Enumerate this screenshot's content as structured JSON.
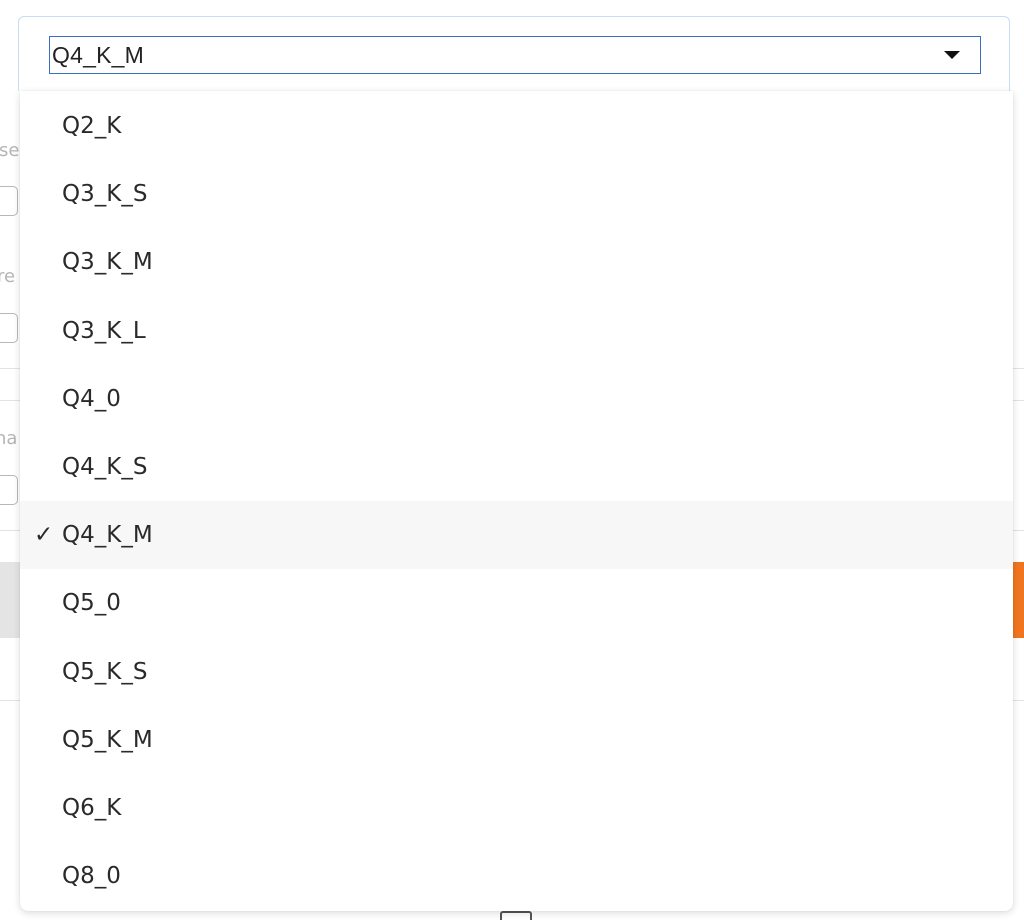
{
  "background": {
    "labels": [
      "lse",
      "re",
      "ha"
    ]
  },
  "select": {
    "value": "Q4_K_M",
    "caret_icon": "chevron-down-icon"
  },
  "dropdown": {
    "check_glyph": "✓",
    "selected_index": 6,
    "options": [
      "Q2_K",
      "Q3_K_S",
      "Q3_K_M",
      "Q3_K_L",
      "Q4_0",
      "Q4_K_S",
      "Q4_K_M",
      "Q5_0",
      "Q5_K_S",
      "Q5_K_M",
      "Q6_K",
      "Q8_0"
    ]
  },
  "colors": {
    "accent_border": "#3a6fc4",
    "focus_ring": "#c7dcf5",
    "selected_row_bg": "#f7f7f7",
    "orange_button": "#f07521"
  }
}
